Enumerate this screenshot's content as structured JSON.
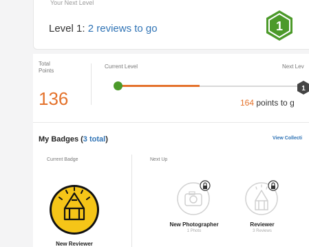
{
  "level_card": {
    "faded_text": "Your Next Level",
    "level_prefix": "Level 1: ",
    "level_link": "2 reviews to go",
    "badge_number": "1"
  },
  "points": {
    "total_label_line1": "Total",
    "total_label_line2": "Points",
    "total_value": "136",
    "current_level_label": "Current Level",
    "next_level_label": "Next Lev",
    "end_badge_number": "1",
    "points_to_go_number": "164",
    "points_to_go_text": " points to g",
    "progress_fraction": 0.41
  },
  "badges": {
    "title": "My Badges (",
    "count": "3 total",
    "title_close": ")",
    "view_collection": "View Collecti",
    "current_badge_label": "Current Badge",
    "next_up_label": "Next Up",
    "current_badge_name": "New Reviewer",
    "next": [
      {
        "name": "New Photographer",
        "sub": "1 Photo"
      },
      {
        "name": "Reviewer",
        "sub": "3 Reviews"
      }
    ]
  },
  "colors": {
    "accent_orange": "#e4722b",
    "level_green": "#4c9a2a",
    "link_blue": "#2f73b5",
    "badge_yellow": "#f5c518"
  }
}
